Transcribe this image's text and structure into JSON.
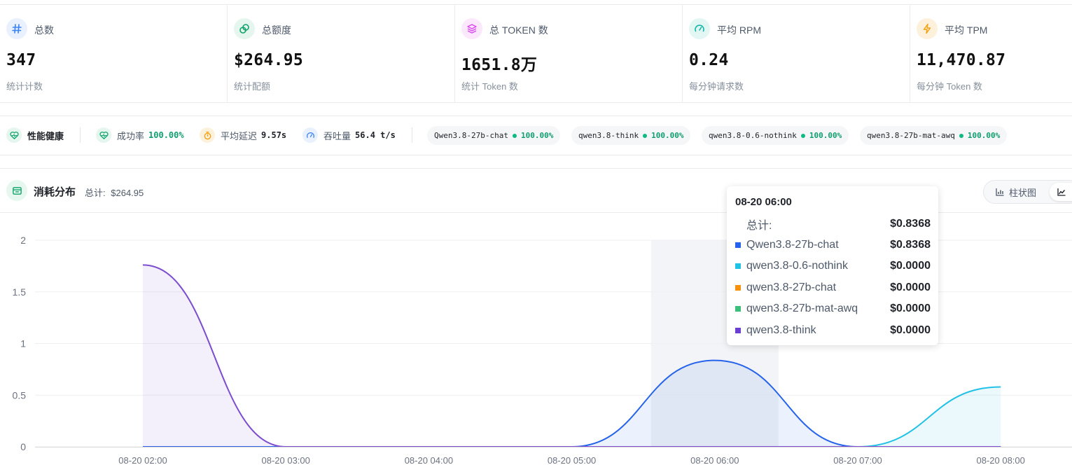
{
  "stats": [
    {
      "label": "总数",
      "value": "347",
      "sub": "统计计数",
      "icon": "hash-icon",
      "color": "#3b82f6",
      "bg": "#e8f1fd"
    },
    {
      "label": "总额度",
      "value": "$264.95",
      "sub": "统计配额",
      "icon": "coins-icon",
      "color": "#10a36b",
      "bg": "#e4f6ee"
    },
    {
      "label": "总 TOKEN 数",
      "value": "1651.8万",
      "sub": "统计 Token 数",
      "icon": "layers-icon",
      "color": "#d946ef",
      "bg": "#fbe8fd"
    },
    {
      "label": "平均 RPM",
      "value": "0.24",
      "sub": "每分钟请求数",
      "icon": "gauge-icon",
      "color": "#14b8a6",
      "bg": "#e2f6f4"
    },
    {
      "label": "平均 TPM",
      "value": "11,470.87",
      "sub": "每分钟 Token 数",
      "icon": "bolt-icon",
      "color": "#f59e0b",
      "bg": "#fdf1dc"
    }
  ],
  "health": {
    "title": "性能健康",
    "success_label": "成功率",
    "success_value": "100.00%",
    "latency_label": "平均延迟",
    "latency_value": "9.57s",
    "throughput_label": "吞吐量",
    "throughput_value": "56.4 t/s",
    "models": [
      {
        "name": "Qwen3.8-27b-chat",
        "pct": "100.00%"
      },
      {
        "name": "qwen3.8-think",
        "pct": "100.00%"
      },
      {
        "name": "qwen3.8-0.6-nothink",
        "pct": "100.00%"
      },
      {
        "name": "qwen3.8-27b-mat-awq",
        "pct": "100.00%"
      }
    ]
  },
  "consumption": {
    "title": "消耗分布",
    "total_label": "总计:",
    "total_value": "$264.95",
    "view_bar": "柱状图",
    "view_line_icon": "area-chart-icon"
  },
  "tooltip": {
    "title": "08-20 06:00",
    "total_label": "总计:",
    "total_value": "$0.8368",
    "rows": [
      {
        "name": "Qwen3.8-27b-chat",
        "value": "$0.8368",
        "color": "#2563eb"
      },
      {
        "name": "qwen3.8-0.6-nothink",
        "value": "$0.0000",
        "color": "#22c1e6"
      },
      {
        "name": "qwen3.8-27b-chat",
        "value": "$0.0000",
        "color": "#f7900a"
      },
      {
        "name": "qwen3.8-27b-mat-awq",
        "value": "$0.0000",
        "color": "#3bbf7a"
      },
      {
        "name": "qwen3.8-think",
        "value": "$0.0000",
        "color": "#6d3fd0"
      }
    ]
  },
  "chart_data": {
    "type": "area",
    "x": [
      "08-20 02:00",
      "08-20 03:00",
      "08-20 04:00",
      "08-20 05:00",
      "08-20 06:00",
      "08-20 07:00",
      "08-20 08:00"
    ],
    "ylim": [
      0,
      2
    ],
    "yticks": [
      "0",
      "0.5",
      "1",
      "1.5",
      "2"
    ],
    "grid": true,
    "highlight_category": "08-20 06:00",
    "series": [
      {
        "name": "Qwen3.8-27b-chat",
        "color": "#2563eb",
        "values": [
          0,
          0,
          0,
          0,
          0.8368,
          0,
          0
        ]
      },
      {
        "name": "qwen3.8-0.6-nothink",
        "color": "#22c1e6",
        "values": [
          0,
          0,
          0,
          0,
          0,
          0,
          0.58
        ]
      },
      {
        "name": "qwen3.8-27b-chat",
        "color": "#f7900a",
        "values": [
          0,
          0,
          0,
          0,
          0,
          0,
          0
        ]
      },
      {
        "name": "qwen3.8-27b-mat-awq",
        "color": "#3bbf7a",
        "values": [
          0,
          0,
          0,
          0,
          0,
          0,
          0
        ]
      },
      {
        "name": "qwen3.8-think",
        "color": "#7c4dcf",
        "values": [
          1.76,
          0,
          0,
          0,
          0,
          0,
          0
        ]
      }
    ]
  }
}
